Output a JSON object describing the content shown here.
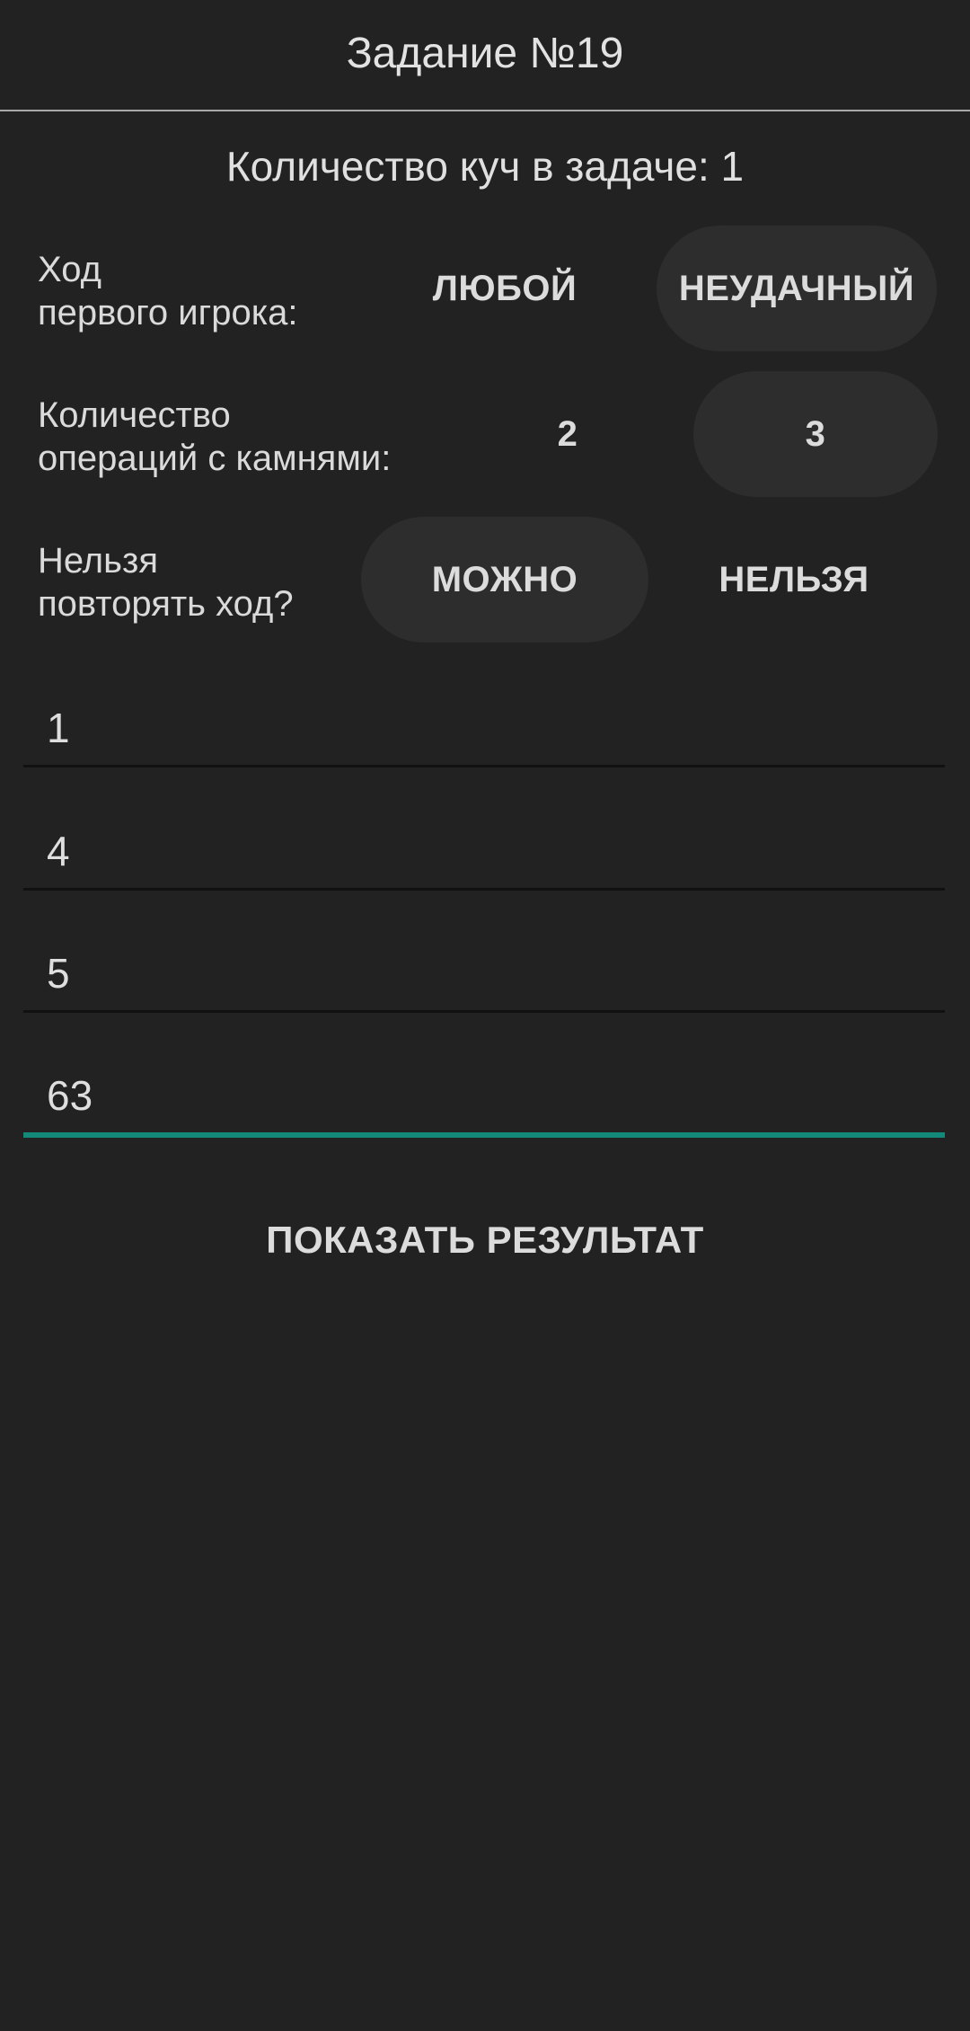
{
  "app_bar": {
    "title": "Задание №19"
  },
  "pile_count_text": "Количество куч в задаче: 1",
  "settings": {
    "first_move": {
      "label_line1": "Ход",
      "label_line2": "первого игрока:",
      "options": [
        "ЛЮБОЙ",
        "НЕУДАЧНЫЙ"
      ],
      "selected": "НЕУДАЧНЫЙ"
    },
    "operations": {
      "label_line1": "Количество",
      "label_line2": "операций с камнями:",
      "options": [
        "2",
        "3"
      ],
      "selected": "3"
    },
    "repeat_move": {
      "label_line1": "Нельзя",
      "label_line2": "повторять ход?",
      "options": [
        "МОЖНО",
        "НЕЛЬЗЯ"
      ],
      "selected": "МОЖНО"
    }
  },
  "inputs": [
    {
      "value": "1"
    },
    {
      "value": "4"
    },
    {
      "value": "5"
    },
    {
      "value": "63",
      "focused": true
    }
  ],
  "accent_color": "#13897a",
  "show_result_label": "ПОКАЗАТЬ РЕЗУЛЬТАТ"
}
